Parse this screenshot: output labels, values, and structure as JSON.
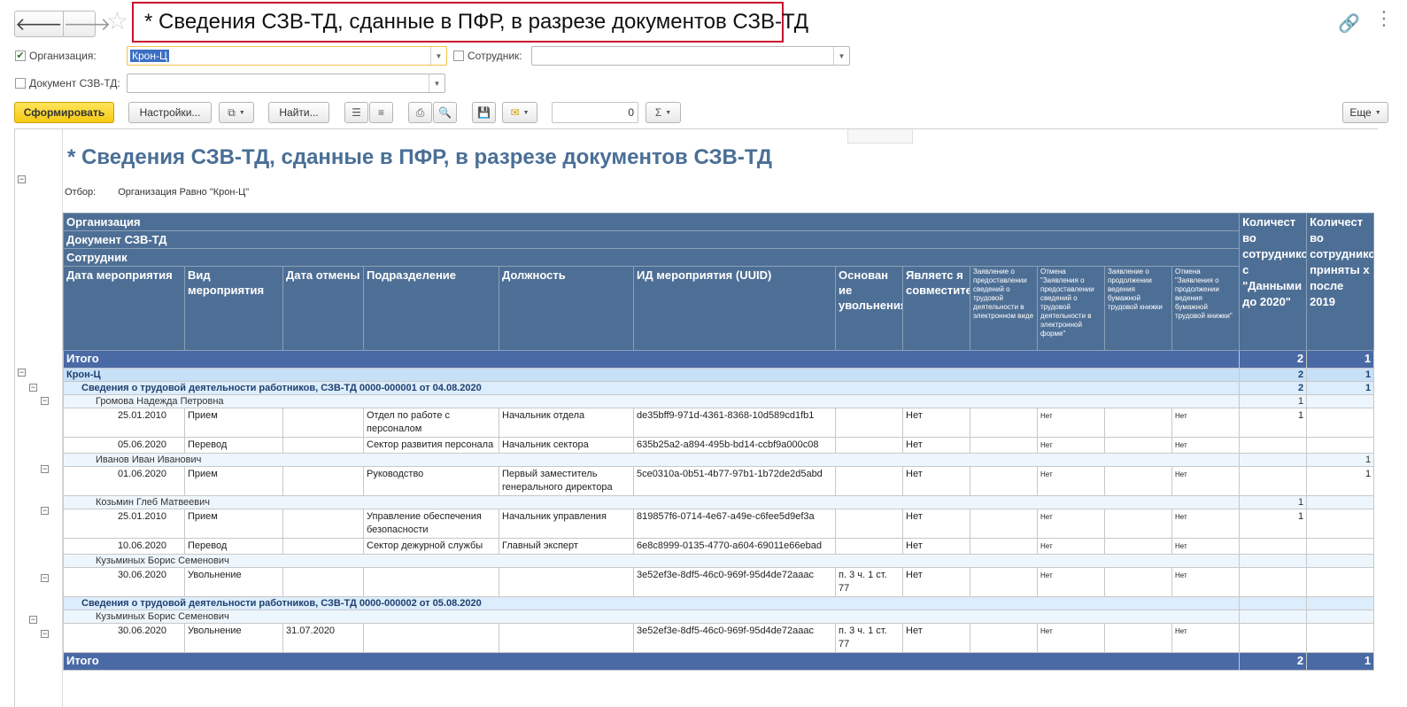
{
  "window": {
    "title": "* Сведения СЗВ-ТД, сданные в ПФР, в разрезе документов СЗВ-ТД",
    "back_glyph": "🡐",
    "forward_glyph": "🡒",
    "icons": {
      "favorite": "star-icon",
      "link": "link-icon",
      "menu": "more-vertical-icon"
    }
  },
  "filters": {
    "organization": {
      "label": "Организация:",
      "checked": true,
      "value": "Крон-Ц"
    },
    "employee": {
      "label": "Сотрудник:",
      "checked": false,
      "value": ""
    },
    "document": {
      "label": "Документ СЗВ-ТД:",
      "checked": false,
      "value": ""
    }
  },
  "toolbar": {
    "generate_label": "Сформировать",
    "settings_label": "Настройки...",
    "find_label": "Найти...",
    "sum_value": "0",
    "sigma": "Σ",
    "more_label": "Еще"
  },
  "report": {
    "title": "* Сведения СЗВ-ТД, сданные в ПФР, в разрезе документов СЗВ-ТД",
    "filter_label": "Отбор:",
    "filter_value": "Организация Равно \"Крон-Ц\"",
    "group_headers": [
      "Организация",
      "Документ СЗВ-ТД",
      "Сотрудник"
    ],
    "columns": [
      "Дата мероприятия",
      "Вид мероприятия",
      "Дата отмены",
      "Подразделение",
      "Должность",
      "ИД мероприятия (UUID)",
      "Основание увольнения",
      "Является совместителем",
      "Заявление о предоставлении сведений о трудовой деятельности в электронном виде",
      "Отмена \"Заявления о предоставлении сведений о трудовой деятельности в электронной форме\"",
      "Заявление о продолжении ведения бумажной трудовой книжки",
      "Отмена \"Заявления о продолжении ведения бумажной трудовой книжки\"",
      "Количество сотрудников с \"Данными до 2020\"",
      "Количество сотрудников, принятых после 2019"
    ],
    "column_display": {
      "osnovanie": "Основан ие увольнения",
      "sovmest": "Являетс я совместителем",
      "count1": "Количест во сотрудников с \"Данными до 2020\"",
      "count2": "Количест во сотрудников, приняты х после 2019"
    },
    "total": {
      "label": "Итого",
      "count1": "2",
      "count2": "1"
    },
    "org": {
      "name": "Крон-Ц",
      "count1": "2",
      "count2": "1"
    },
    "docs": [
      {
        "name": "Сведения о трудовой деятельности работников, СЗВ-ТД 0000-000001 от 04.08.2020",
        "count1": "2",
        "count2": "1",
        "employees": [
          {
            "name": "Громова Надежда Петровна",
            "count1": "1",
            "count2": "",
            "events": [
              {
                "date": "25.01.2010",
                "type": "Прием",
                "cancel": "",
                "dept": "Отдел по работе с персоналом",
                "pos": "Начальник отдела",
                "uuid": "de35bff9-971d-4361-8368-10d589cd1fb1",
                "reason": "",
                "part": "Нет",
                "app": "",
                "app_cancel": "Нет",
                "paper": "",
                "paper_cancel": "Нет",
                "count1": "1",
                "count2": ""
              },
              {
                "date": "05.06.2020",
                "type": "Перевод",
                "cancel": "",
                "dept": "Сектор развития персонала",
                "pos": "Начальник сектора",
                "uuid": "635b25a2-a894-495b-bd14-ccbf9a000c08",
                "reason": "",
                "part": "Нет",
                "app": "",
                "app_cancel": "Нет",
                "paper": "",
                "paper_cancel": "Нет",
                "count1": "",
                "count2": ""
              }
            ]
          },
          {
            "name": "Иванов Иван Иванович",
            "count1": "",
            "count2": "1",
            "events": [
              {
                "date": "01.06.2020",
                "type": "Прием",
                "cancel": "",
                "dept": "Руководство",
                "pos": "Первый заместитель генерального директора",
                "uuid": "5ce0310a-0b51-4b77-97b1-1b72de2d5abd",
                "reason": "",
                "part": "Нет",
                "app": "",
                "app_cancel": "Нет",
                "paper": "",
                "paper_cancel": "Нет",
                "count1": "",
                "count2": "1"
              }
            ]
          },
          {
            "name": "Козьмин Глеб Матвеевич",
            "count1": "1",
            "count2": "",
            "events": [
              {
                "date": "25.01.2010",
                "type": "Прием",
                "cancel": "",
                "dept": "Управление обеспечения безопасности",
                "pos": "Начальник управления",
                "uuid": "819857f6-0714-4e67-a49e-c6fee5d9ef3a",
                "reason": "",
                "part": "Нет",
                "app": "",
                "app_cancel": "Нет",
                "paper": "",
                "paper_cancel": "Нет",
                "count1": "1",
                "count2": ""
              },
              {
                "date": "10.06.2020",
                "type": "Перевод",
                "cancel": "",
                "dept": "Сектор дежурной службы",
                "pos": "Главный эксперт",
                "uuid": "6e8c8999-0135-4770-a604-69011e66ebad",
                "reason": "",
                "part": "Нет",
                "app": "",
                "app_cancel": "Нет",
                "paper": "",
                "paper_cancel": "Нет",
                "count1": "",
                "count2": ""
              }
            ]
          },
          {
            "name": "Кузьминых Борис Семенович",
            "count1": "",
            "count2": "",
            "events": [
              {
                "date": "30.06.2020",
                "type": "Увольнение",
                "cancel": "",
                "dept": "",
                "pos": "",
                "uuid": "3e52ef3e-8df5-46c0-969f-95d4de72aaac",
                "reason": "п. 3 ч. 1 ст. 77",
                "part": "Нет",
                "app": "",
                "app_cancel": "Нет",
                "paper": "",
                "paper_cancel": "Нет",
                "count1": "",
                "count2": ""
              }
            ]
          }
        ]
      },
      {
        "name": "Сведения о трудовой деятельности работников, СЗВ-ТД 0000-000002 от 05.08.2020",
        "count1": "",
        "count2": "",
        "employees": [
          {
            "name": "Кузьминых Борис Семенович",
            "count1": "",
            "count2": "",
            "events": [
              {
                "date": "30.06.2020",
                "type": "Увольнение",
                "cancel": "31.07.2020",
                "dept": "",
                "pos": "",
                "uuid": "3e52ef3e-8df5-46c0-969f-95d4de72aaac",
                "reason": "п. 3 ч. 1 ст. 77",
                "part": "Нет",
                "app": "",
                "app_cancel": "Нет",
                "paper": "",
                "paper_cancel": "Нет",
                "count1": "",
                "count2": ""
              }
            ]
          }
        ]
      }
    ],
    "bottom_total": {
      "label": "Итого",
      "count1": "2",
      "count2": "1"
    }
  },
  "colors": {
    "header_bg": "#4e6f95",
    "total_bg": "#4a6aa6",
    "org_bg": "#c6e0f7",
    "doc_bg": "#dcedfb",
    "title_text": "#4a6f96",
    "highlight_border": "#c8102e",
    "primary_button": "#f6c913"
  }
}
